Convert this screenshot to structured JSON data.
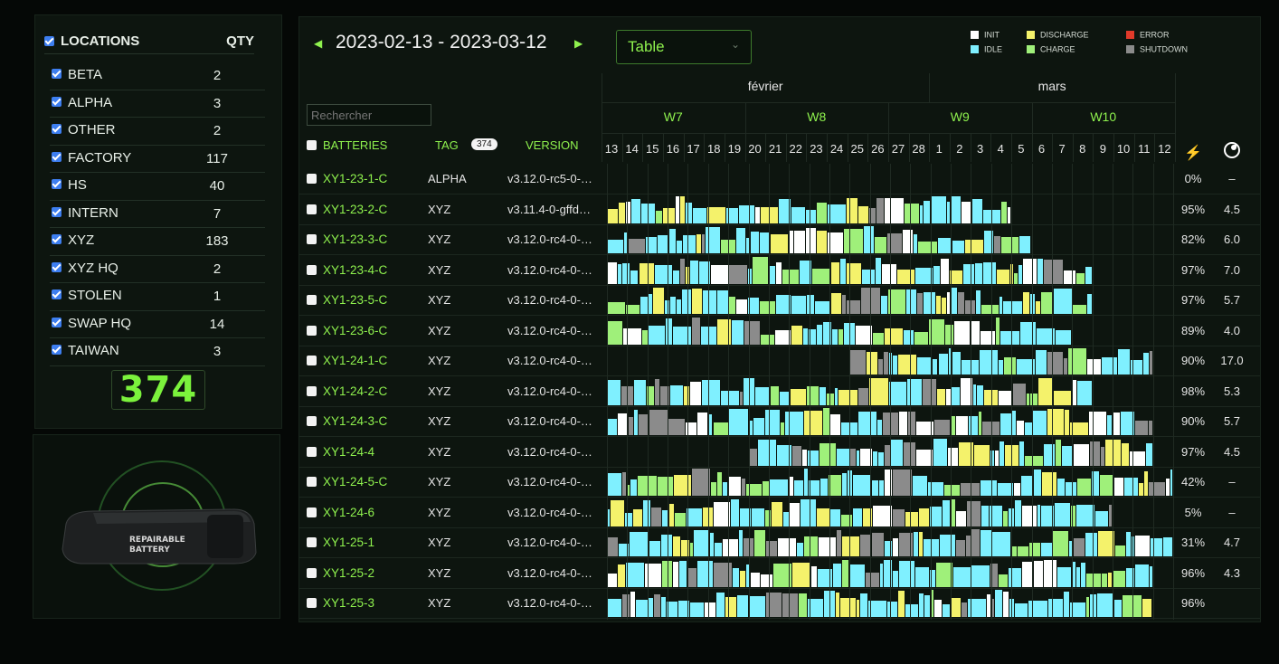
{
  "locations": {
    "header_label": "LOCATIONS",
    "qty_label": "QTY",
    "items": [
      {
        "name": "BETA",
        "qty": "2"
      },
      {
        "name": "ALPHA",
        "qty": "3"
      },
      {
        "name": "OTHER",
        "qty": "2"
      },
      {
        "name": "FACTORY",
        "qty": "117"
      },
      {
        "name": "HS",
        "qty": "40"
      },
      {
        "name": "INTERN",
        "qty": "7"
      },
      {
        "name": "XYZ",
        "qty": "183"
      },
      {
        "name": "XYZ HQ",
        "qty": "2"
      },
      {
        "name": "STOLEN",
        "qty": "1"
      },
      {
        "name": "SWAP HQ",
        "qty": "14"
      },
      {
        "name": "TAIWAN",
        "qty": "3"
      }
    ],
    "total": "374"
  },
  "product_image": {
    "label_line1": "REPAIRABLE",
    "label_line2": "BATTERY"
  },
  "toolbar": {
    "date_range": "2023-02-13 - 2023-03-12",
    "prev_arrow": "◀",
    "next_arrow": "▶",
    "view_select_value": "Table",
    "chevron": "⌄"
  },
  "legend": {
    "items": [
      {
        "label": "INIT",
        "color": "#ffffff"
      },
      {
        "label": "IDLE",
        "color": "#7ff0ff"
      },
      {
        "label": "DISCHARGE",
        "color": "#f4f26b"
      },
      {
        "label": "CHARGE",
        "color": "#9ff07a"
      },
      {
        "label": "ERROR",
        "color": "#e03a2a"
      },
      {
        "label": "SHUTDOWN",
        "color": "#8b8b8b"
      }
    ]
  },
  "search": {
    "placeholder": "Rechercher"
  },
  "columns": {
    "batteries": "BATTERIES",
    "tag": "TAG",
    "tag_count": "374",
    "version": "VERSION",
    "bolt": "⚡"
  },
  "calendar": {
    "months": [
      {
        "label": "février",
        "start": 0,
        "span": 16
      },
      {
        "label": "mars",
        "start": 16,
        "span": 12
      }
    ],
    "weeks": [
      {
        "label": "W7",
        "start": 0,
        "span": 7
      },
      {
        "label": "W8",
        "start": 7,
        "span": 7
      },
      {
        "label": "W9",
        "start": 14,
        "span": 7
      },
      {
        "label": "W10",
        "start": 21,
        "span": 7
      }
    ],
    "days": [
      "13",
      "14",
      "15",
      "16",
      "17",
      "18",
      "19",
      "20",
      "21",
      "22",
      "23",
      "24",
      "25",
      "26",
      "27",
      "28",
      "1",
      "2",
      "3",
      "4",
      "5",
      "6",
      "7",
      "8",
      "9",
      "10",
      "11",
      "12"
    ]
  },
  "rows": [
    {
      "name": "XY1-23-1-C",
      "tag": "ALPHA",
      "version": "v3.12.0-rc5-0-…",
      "pct": "0%",
      "ah": "–",
      "pattern": [],
      "start": 0,
      "end": 0
    },
    {
      "name": "XY1-23-2-C",
      "tag": "XYZ",
      "version": "v3.11.4-0-gffd…",
      "pct": "95%",
      "ah": "4.5",
      "pattern": "mix",
      "start": 0,
      "end": 20
    },
    {
      "name": "XY1-23-3-C",
      "tag": "XYZ",
      "version": "v3.12.0-rc4-0-…",
      "pct": "82%",
      "ah": "6.0",
      "pattern": "mix",
      "start": 0,
      "end": 21
    },
    {
      "name": "XY1-23-4-C",
      "tag": "XYZ",
      "version": "v3.12.0-rc4-0-…",
      "pct": "97%",
      "ah": "7.0",
      "pattern": "mix",
      "start": 0,
      "end": 24
    },
    {
      "name": "XY1-23-5-C",
      "tag": "XYZ",
      "version": "v3.12.0-rc4-0-…",
      "pct": "97%",
      "ah": "5.7",
      "pattern": "mix",
      "start": 0,
      "end": 24
    },
    {
      "name": "XY1-23-6-C",
      "tag": "XYZ",
      "version": "v3.12.0-rc4-0-…",
      "pct": "89%",
      "ah": "4.0",
      "pattern": "mix",
      "start": 0,
      "end": 23
    },
    {
      "name": "XY1-24-1-C",
      "tag": "XYZ",
      "version": "v3.12.0-rc4-0-…",
      "pct": "90%",
      "ah": "17.0",
      "pattern": "mix",
      "start": 12,
      "end": 27
    },
    {
      "name": "XY1-24-2-C",
      "tag": "XYZ",
      "version": "v3.12.0-rc4-0-…",
      "pct": "98%",
      "ah": "5.3",
      "pattern": "mix",
      "start": 0,
      "end": 24
    },
    {
      "name": "XY1-24-3-C",
      "tag": "XYZ",
      "version": "v3.12.0-rc4-0-…",
      "pct": "90%",
      "ah": "5.7",
      "pattern": "mix",
      "start": 0,
      "end": 27
    },
    {
      "name": "XY1-24-4",
      "tag": "XYZ",
      "version": "v3.12.0-rc4-0-…",
      "pct": "97%",
      "ah": "4.5",
      "pattern": "mix",
      "start": 7,
      "end": 27
    },
    {
      "name": "XY1-24-5-C",
      "tag": "XYZ",
      "version": "v3.12.0-rc4-0-…",
      "pct": "42%",
      "ah": "–",
      "pattern": "mix",
      "start": 0,
      "end": 28
    },
    {
      "name": "XY1-24-6",
      "tag": "XYZ",
      "version": "v3.12.0-rc4-0-…",
      "pct": "5%",
      "ah": "–",
      "pattern": "mix",
      "start": 0,
      "end": 25
    },
    {
      "name": "XY1-25-1",
      "tag": "XYZ",
      "version": "v3.12.0-rc4-0-…",
      "pct": "31%",
      "ah": "4.7",
      "pattern": "mix",
      "start": 0,
      "end": 28
    },
    {
      "name": "XY1-25-2",
      "tag": "XYZ",
      "version": "v3.12.0-rc4-0-…",
      "pct": "96%",
      "ah": "4.3",
      "pattern": "mix",
      "start": 0,
      "end": 27
    },
    {
      "name": "XY1-25-3",
      "tag": "XYZ",
      "version": "v3.12.0-rc4-0-…",
      "pct": "96%",
      "ah": "",
      "pattern": "mix",
      "start": 0,
      "end": 27
    }
  ]
}
